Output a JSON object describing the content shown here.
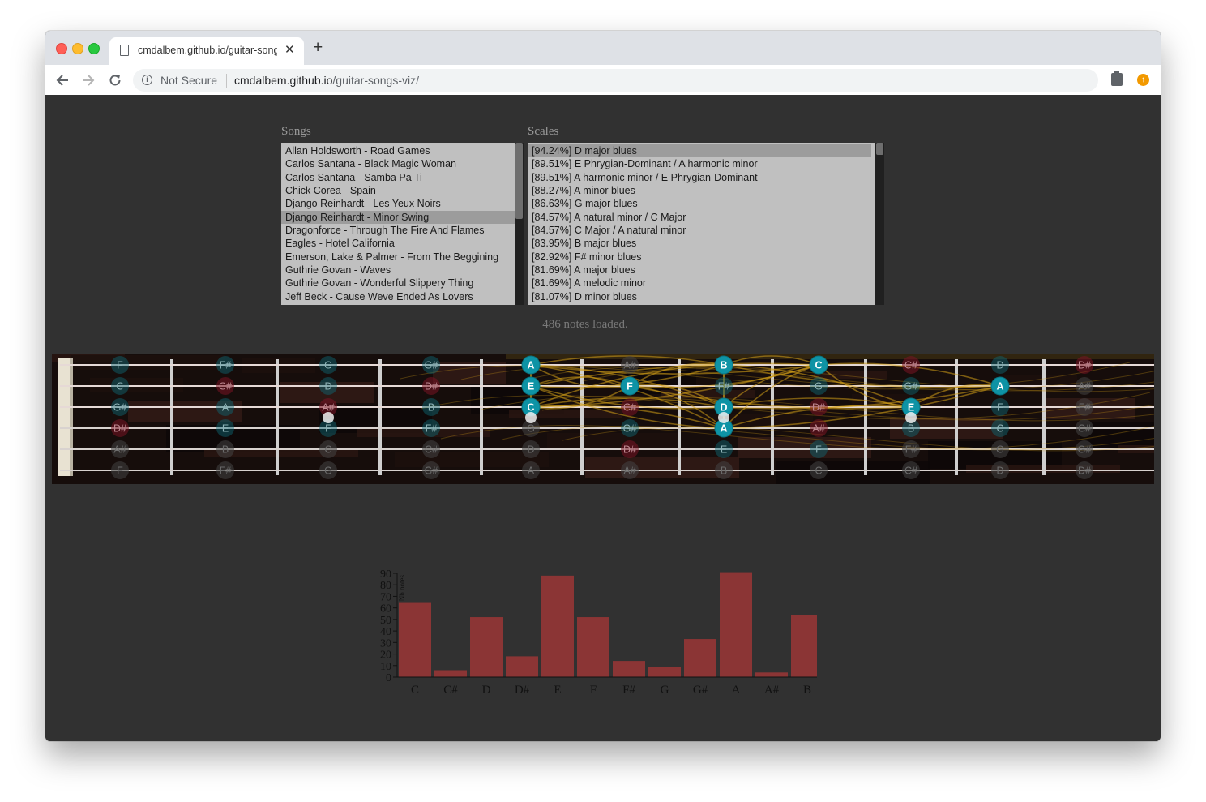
{
  "browser": {
    "tab_title": "cmdalbem.github.io/guitar-songs-viz/",
    "close_glyph": "✕",
    "new_tab_glyph": "+",
    "security_label": "Not Secure",
    "url_host": "cmdalbem.github.io",
    "url_path": "/guitar-songs-viz/",
    "icons": [
      "back-arrow-icon",
      "forward-arrow-icon",
      "reload-icon",
      "info-icon",
      "clipboard-extension-icon",
      "update-extension-icon"
    ]
  },
  "songs": {
    "label": "Songs",
    "selected_index": 5,
    "items": [
      "Allan Holdsworth - Road Games",
      "Carlos Santana - Black Magic Woman",
      "Carlos Santana - Samba Pa Ti",
      "Chick Corea - Spain",
      "Django Reinhardt - Les Yeux Noirs",
      "Django Reinhardt - Minor Swing",
      "Dragonforce - Through The Fire And Flames",
      "Eagles - Hotel California",
      "Emerson, Lake & Palmer - From The Beggining",
      "Guthrie Govan - Waves",
      "Guthrie Govan - Wonderful Slippery Thing",
      "Jeff Beck - Cause Weve Ended As Lovers"
    ]
  },
  "scales": {
    "label": "Scales",
    "selected_index": 0,
    "items": [
      "[94.24%] D major blues",
      "[89.51%] E Phrygian-Dominant / A harmonic minor",
      "[89.51%] A harmonic minor / E Phrygian-Dominant",
      "[88.27%] A minor blues",
      "[86.63%] G major blues",
      "[84.57%] A natural minor / C Major",
      "[84.57%] C Major / A natural minor",
      "[83.95%] B major blues",
      "[82.92%] F# minor blues",
      "[81.69%] A major blues",
      "[81.69%] A melodic minor",
      "[81.07%] D minor blues"
    ]
  },
  "status_text": "486 notes loaded.",
  "fretboard": {
    "strings": [
      {
        "notes": [
          "F",
          "F#",
          "G",
          "G#",
          "A",
          "A#",
          "B",
          "C",
          "C#",
          "D",
          "D#"
        ],
        "state": [
          "t",
          "t",
          "t",
          "t",
          "h",
          "g",
          "h",
          "h",
          "r",
          "t",
          "r"
        ]
      },
      {
        "notes": [
          "C",
          "C#",
          "D",
          "D#",
          "E",
          "F",
          "F#",
          "G",
          "G#",
          "A",
          "A#"
        ],
        "state": [
          "t",
          "r",
          "t",
          "r",
          "h",
          "h",
          "t",
          "t",
          "t",
          "h",
          "g"
        ]
      },
      {
        "notes": [
          "G#",
          "A",
          "A#",
          "B",
          "C",
          "C#",
          "D",
          "D#",
          "E",
          "F",
          "F#"
        ],
        "state": [
          "t",
          "t",
          "r",
          "t",
          "h",
          "r",
          "h",
          "r",
          "h",
          "t",
          "g"
        ]
      },
      {
        "notes": [
          "D#",
          "E",
          "F",
          "F#",
          "G",
          "G#",
          "A",
          "A#",
          "B",
          "C",
          "C#"
        ],
        "state": [
          "r",
          "t",
          "t",
          "t",
          "g",
          "t",
          "h",
          "r",
          "t",
          "t",
          "g"
        ]
      },
      {
        "notes": [
          "A#",
          "B",
          "C",
          "C#",
          "D",
          "D#",
          "E",
          "F",
          "F#",
          "G",
          "G#"
        ],
        "state": [
          "g",
          "g",
          "g",
          "g",
          "g",
          "r",
          "t",
          "t",
          "g",
          "g",
          "g"
        ]
      },
      {
        "notes": [
          "F",
          "F#",
          "G",
          "G#",
          "A",
          "A#",
          "B",
          "C",
          "C#",
          "D",
          "D#"
        ],
        "state": [
          "g",
          "g",
          "g",
          "g",
          "g",
          "g",
          "g",
          "g",
          "g",
          "g",
          "g"
        ]
      }
    ],
    "colors": {
      "highlight": "#0e93a5",
      "teal": "#0d6b78",
      "red": "#7a1424",
      "grey": "#444444",
      "chord": "#d4a017"
    }
  },
  "chart_data": {
    "type": "bar",
    "categories": [
      "C",
      "C#",
      "D",
      "D#",
      "E",
      "F",
      "F#",
      "G",
      "G#",
      "A",
      "A#",
      "B"
    ],
    "values": [
      65,
      6,
      52,
      18,
      88,
      52,
      14,
      9,
      33,
      91,
      4,
      54
    ],
    "ylabel": "Nb notes",
    "xlabel": "",
    "title": "",
    "ylim": [
      0,
      90
    ],
    "yticks": [
      0,
      10,
      20,
      30,
      40,
      50,
      60,
      70,
      80,
      90
    ],
    "bar_color": "#8b3535"
  }
}
